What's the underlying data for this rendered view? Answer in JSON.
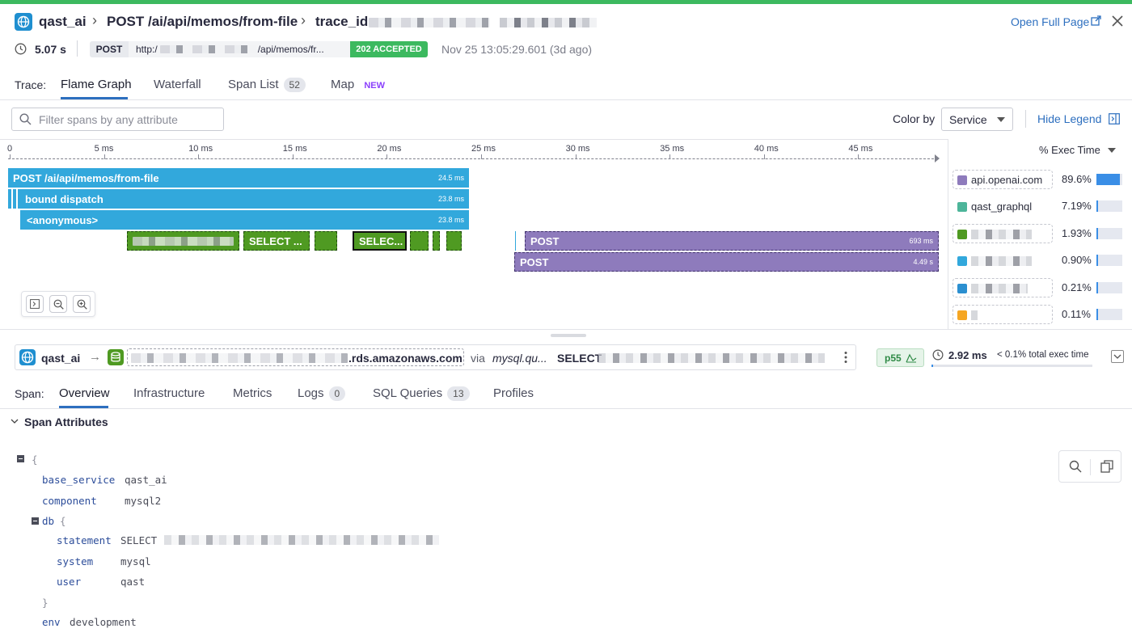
{
  "header": {
    "service": "qast_ai",
    "resource": "POST /ai/api/memos/from-file",
    "trace_label": "trace_id",
    "open_full_page": "Open Full Page",
    "duration": "5.07 s",
    "method": "POST",
    "url_prefix": "http:/",
    "url_suffix": "/api/memos/fr...",
    "status": "202 ACCEPTED",
    "timestamp": "Nov 25 13:05:29.601 (3d ago)"
  },
  "trace_tabs": {
    "label": "Trace:",
    "items": [
      {
        "label": "Flame Graph"
      },
      {
        "label": "Waterfall"
      },
      {
        "label": "Span List",
        "count": "52"
      },
      {
        "label": "Map",
        "badge": "NEW"
      }
    ]
  },
  "filter": {
    "placeholder": "Filter spans by any attribute",
    "color_by_label": "Color by",
    "color_by_value": "Service",
    "hide_legend": "Hide Legend"
  },
  "timeline": {
    "ticks": [
      "0",
      "5 ms",
      "10 ms",
      "15 ms",
      "20 ms",
      "25 ms",
      "30 ms",
      "35 ms",
      "40 ms",
      "45 ms"
    ]
  },
  "spans": {
    "root": {
      "label": "POST /ai/api/memos/from-file",
      "duration": "24.5 ms"
    },
    "bound": {
      "label": "bound dispatch",
      "duration": "23.8 ms"
    },
    "anon": {
      "label": "<anonymous>",
      "duration": "23.8 ms"
    },
    "select1": {
      "label": "SELECT ..."
    },
    "select2": {
      "label": "SELEC..."
    },
    "post1": {
      "label": "POST",
      "duration": "693 ms"
    },
    "post2": {
      "label": "POST",
      "duration": "4.49 s"
    }
  },
  "legend": {
    "header": "% Exec Time",
    "items": [
      {
        "name": "api.openai.com",
        "pct": "89.6%",
        "color": "#8e7bbc",
        "fill": 0.896
      },
      {
        "name": "qast_graphql",
        "pct": "7.19%",
        "color": "#4db59a",
        "fill": 0.0719
      },
      {
        "name": "",
        "pct": "1.93%",
        "color": "#4f9a22",
        "fill": 0.0193
      },
      {
        "name": "",
        "pct": "0.90%",
        "color": "#32a8dc",
        "fill": 0.009
      },
      {
        "name": "",
        "pct": "0.21%",
        "color": "#2b8fd0",
        "fill": 0.0021
      },
      {
        "name": "",
        "pct": "0.11%",
        "color": "#f5a623",
        "fill": 0.0011
      }
    ]
  },
  "span_header": {
    "service": "qast_ai",
    "db_host_suffix": ".rds.amazonaws.com",
    "via": "via",
    "operation": "mysql.qu...",
    "resource_prefix": "SELECT",
    "percentile": "p55",
    "duration": "2.92 ms",
    "exec_share": "< 0.1% total exec time",
    "share_fill": 0.001
  },
  "span_tabs": {
    "label": "Span:",
    "items": [
      {
        "label": "Overview"
      },
      {
        "label": "Infrastructure"
      },
      {
        "label": "Metrics"
      },
      {
        "label": "Logs",
        "count": "0"
      },
      {
        "label": "SQL Queries",
        "count": "13"
      },
      {
        "label": "Profiles"
      }
    ]
  },
  "attributes": {
    "section_title": "Span Attributes",
    "base_service_key": "base_service",
    "base_service": "qast_ai",
    "component_key": "component",
    "component": "mysql2",
    "db_key": "db",
    "statement_key": "statement",
    "statement_prefix": "SELECT",
    "system_key": "system",
    "system": "mysql",
    "user_key": "user",
    "user": "qast",
    "env_key": "env",
    "env": "development"
  },
  "colors": {
    "accent": "#2d6fbf",
    "status_ok": "#3cb95f",
    "openai_purple": "#8e7bbc",
    "service_blue": "#32a8dc",
    "db_green": "#4f9a22"
  }
}
